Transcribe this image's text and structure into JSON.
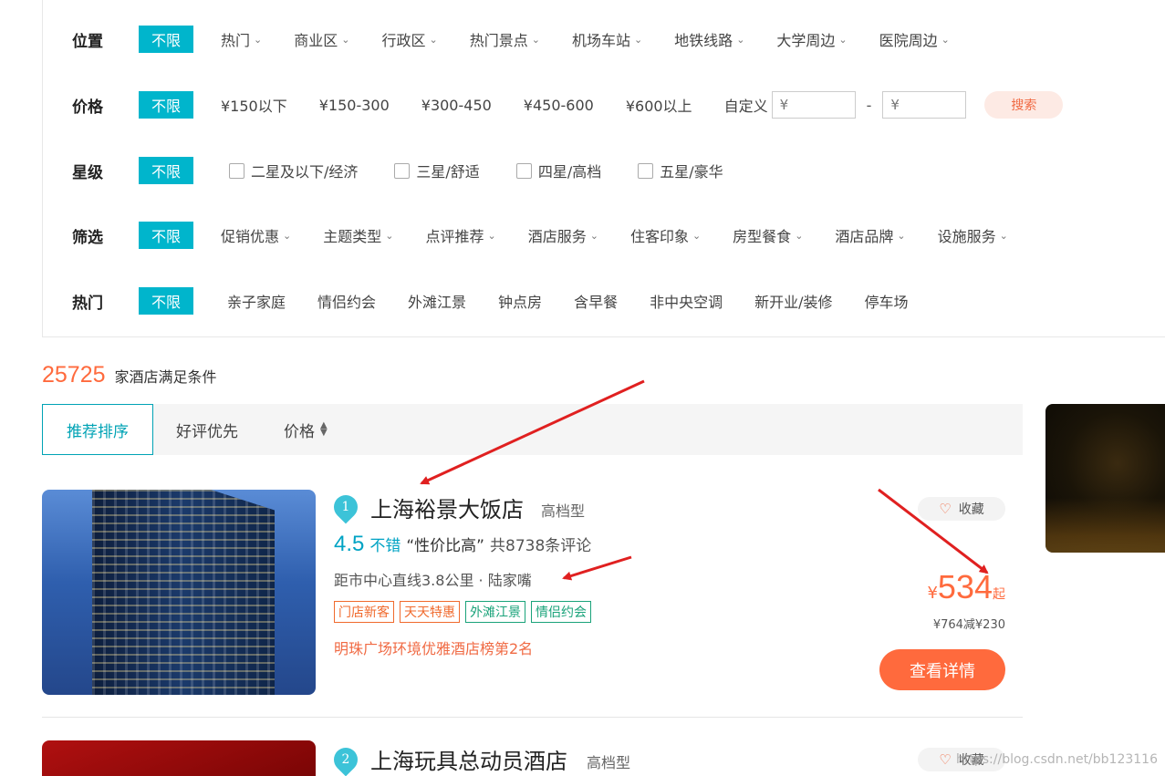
{
  "filters": {
    "rows": [
      {
        "title": "位置",
        "unlimited": "不限",
        "options": [
          "热门",
          "商业区",
          "行政区",
          "热门景点",
          "机场车站",
          "地铁线路",
          "大学周边",
          "医院周边"
        ],
        "dropdown": true
      },
      {
        "title": "价格",
        "unlimited": "不限",
        "options": [
          "¥150以下",
          "¥150-300",
          "¥300-450",
          "¥450-600",
          "¥600以上"
        ],
        "dropdown": false
      },
      {
        "title": "星级",
        "unlimited": "不限",
        "options": [
          "二星及以下/经济",
          "三星/舒适",
          "四星/高档",
          "五星/豪华"
        ],
        "dropdown": false
      },
      {
        "title": "筛选",
        "unlimited": "不限",
        "options": [
          "促销优惠",
          "主题类型",
          "点评推荐",
          "酒店服务",
          "住客印象",
          "房型餐食",
          "酒店品牌",
          "设施服务"
        ],
        "dropdown": true
      },
      {
        "title": "热门",
        "unlimited": "不限",
        "options": [
          "亲子家庭",
          "情侣约会",
          "外滩江景",
          "钟点房",
          "含早餐",
          "非中央空调",
          "新开业/装修",
          "停车场"
        ],
        "dropdown": false
      }
    ],
    "custom_label": "自定义",
    "min_placeholder": "¥",
    "max_placeholder": "¥",
    "dash": "-",
    "search_label": "搜索"
  },
  "results": {
    "count": "25725",
    "count_text": "家酒店满足条件"
  },
  "sort": {
    "tabs": [
      "推荐排序",
      "好评优先",
      "价格"
    ],
    "active": 0
  },
  "hotels": [
    {
      "rank": "1",
      "name": "上海裕景大饭店",
      "type": "高档型",
      "score": "4.5",
      "score_word": "不错",
      "quote": "“性价比高”",
      "reviews": "共8738条评论",
      "location": "距市中心直线3.8公里 · 陆家嘴",
      "tags": [
        {
          "text": "门店新客",
          "color": "orange"
        },
        {
          "text": "天天特惠",
          "color": "orange"
        },
        {
          "text": "外滩江景",
          "color": "green"
        },
        {
          "text": "情侣约会",
          "color": "green"
        }
      ],
      "rank_note": "明珠广场环境优雅酒店榜第2名",
      "fav_label": "收藏",
      "currency": "¥",
      "price": "534",
      "price_suffix": "起",
      "discount": "¥764减¥230",
      "detail_label": "查看详情"
    },
    {
      "rank": "2",
      "name": "上海玩具总动员酒店",
      "type": "高档型",
      "fav_label": "收藏"
    }
  ],
  "watermark": "https://blog.csdn.net/bb123116",
  "colors": {
    "accent": "#00b5cc",
    "price": "#ff6a3d",
    "annotation_arrow": "#e02020"
  }
}
